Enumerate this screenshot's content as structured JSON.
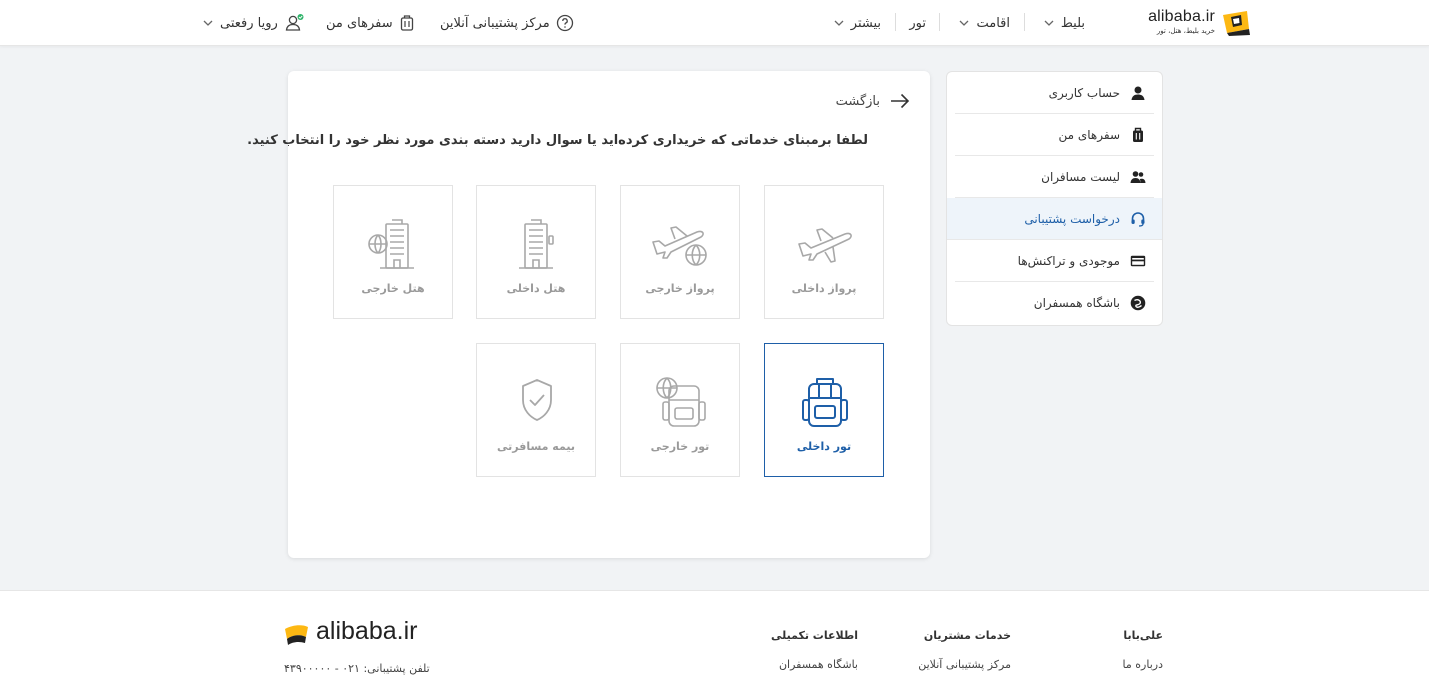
{
  "brand": {
    "name": "alibaba.ir",
    "tagline": "خرید بلیط، هتل، تور",
    "colors": {
      "accent": "#1e5fa8",
      "logo_yellow": "#fdb813",
      "online_dot": "#2fb36a"
    }
  },
  "header": {
    "nav": [
      {
        "label": "بلیط",
        "has_dropdown": true
      },
      {
        "label": "اقامت",
        "has_dropdown": true
      },
      {
        "label": "تور",
        "has_dropdown": false
      },
      {
        "label": "بیشتر",
        "has_dropdown": true
      }
    ],
    "support_center": "مرکز پشتیبانی آنلاین",
    "my_trips": "سفرهای من",
    "user_name": "رویا رفعتی"
  },
  "sidebar": {
    "items": [
      {
        "label": "حساب کاربری",
        "icon": "user-icon",
        "active": false
      },
      {
        "label": "سفرهای من",
        "icon": "suitcase-icon",
        "active": false
      },
      {
        "label": "لیست مسافران",
        "icon": "users-icon",
        "active": false
      },
      {
        "label": "درخواست پشتیبانی",
        "icon": "headset-icon",
        "active": true
      },
      {
        "label": "موجودی و تراکنش‌ها",
        "icon": "card-icon",
        "active": false
      },
      {
        "label": "باشگاه همسفران",
        "icon": "club-icon",
        "active": false
      }
    ]
  },
  "main": {
    "back_label": "بازگشت",
    "instruction": "لطفا برمبنای خدماتی که خریداری کرده‌اید یا سوال دارید دسته بندی مورد نظر خود را انتخاب کنید.",
    "categories": [
      {
        "label": "پرواز داخلی",
        "icon": "plane-icon",
        "selected": false
      },
      {
        "label": "پرواز خارجی",
        "icon": "plane-globe-icon",
        "selected": false
      },
      {
        "label": "هتل داخلی",
        "icon": "hotel-icon",
        "selected": false
      },
      {
        "label": "هتل خارجی",
        "icon": "hotel-globe-icon",
        "selected": false
      },
      {
        "label": "تور داخلی",
        "icon": "backpack-icon",
        "selected": true
      },
      {
        "label": "تور خارجی",
        "icon": "backpack-globe-icon",
        "selected": false
      },
      {
        "label": "بیمه مسافرتی",
        "icon": "shield-check-icon",
        "selected": false
      }
    ]
  },
  "footer": {
    "columns": [
      {
        "heading": "علی‌بابا",
        "link": "درباره ما"
      },
      {
        "heading": "خدمات مشتریان",
        "link": "مرکز پشتیبانی آنلاین"
      },
      {
        "heading": "اطلاعات تکمیلی",
        "link": "باشگاه همسفران"
      }
    ],
    "brand_word": "alibaba.ir",
    "phone_label": "تلفن پشتیبانی:",
    "phone_number": "۰۲۱ - ۴۳۹۰۰۰۰۰"
  }
}
